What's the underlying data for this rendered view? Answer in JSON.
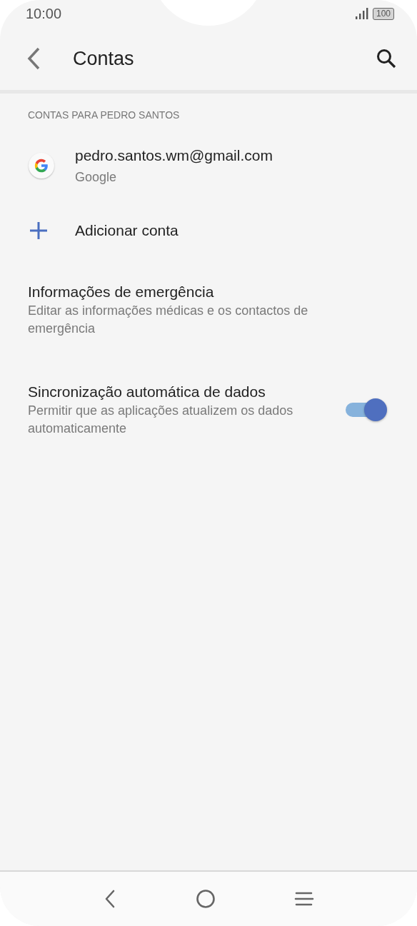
{
  "status_bar": {
    "time": "10:00",
    "battery": "100"
  },
  "toolbar": {
    "title": "Contas"
  },
  "section_header": "CONTAS PARA PEDRO SANTOS",
  "accounts": [
    {
      "email": "pedro.santos.wm@gmail.com",
      "provider": "Google"
    }
  ],
  "add_account": {
    "label": "Adicionar conta"
  },
  "settings": [
    {
      "kind": "plain",
      "title": "Informações de emergência",
      "summary": "Editar as informações médicas e os contactos de emergência"
    },
    {
      "kind": "switch",
      "title": "Sincronização automática de dados",
      "summary": "Permitir que as aplicações atualizem os dados automaticamente",
      "on": true
    }
  ]
}
